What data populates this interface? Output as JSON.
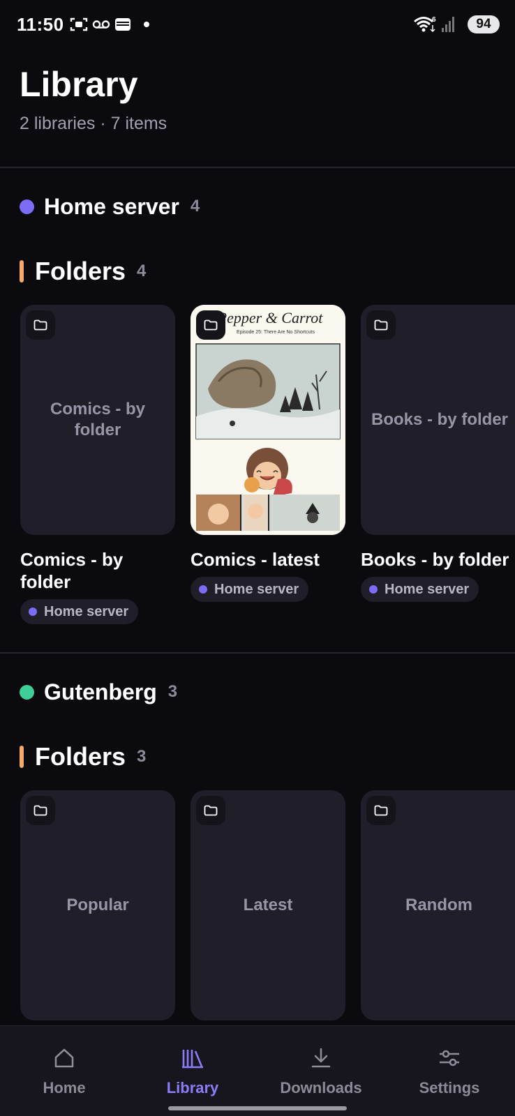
{
  "status_bar": {
    "time": "11:50",
    "battery": "94",
    "icons": [
      "screenshot-icon",
      "voicemail-icon",
      "wallet-icon",
      "wifi-icon",
      "signal-icon"
    ]
  },
  "header": {
    "title": "Library",
    "subtitle": "2 libraries · 7 items"
  },
  "libraries": [
    {
      "name": "Home server",
      "count": "4",
      "dot_color": "#7c6cf6",
      "folders_label": "Folders",
      "folders_count": "4",
      "cards": [
        {
          "title": "Comics - by folder",
          "placeholder": "Comics - by folder",
          "chip": "Home server"
        },
        {
          "title": "Comics - latest",
          "cover": "Pepper & Carrot",
          "cover_subtitle": "Episode 25: There Are No Shortcuts",
          "chip": "Home server"
        },
        {
          "title": "Books - by folder",
          "placeholder": "Books - by folder",
          "chip": "Home server"
        }
      ]
    },
    {
      "name": "Gutenberg",
      "count": "3",
      "dot_color": "#3ecf98",
      "folders_label": "Folders",
      "folders_count": "3",
      "cards": [
        {
          "placeholder": "Popular"
        },
        {
          "placeholder": "Latest"
        },
        {
          "placeholder": "Random"
        }
      ]
    }
  ],
  "bottom_nav": [
    {
      "label": "Home",
      "icon": "home-icon",
      "active": false
    },
    {
      "label": "Library",
      "icon": "library-icon",
      "active": true
    },
    {
      "label": "Downloads",
      "icon": "download-icon",
      "active": false
    },
    {
      "label": "Settings",
      "icon": "settings-sliders-icon",
      "active": false
    }
  ],
  "colors": {
    "background": "#0b0a0f",
    "card": "#1f1e29",
    "accent": "#8b7cf8",
    "folders_bar": "#f4a96a"
  }
}
